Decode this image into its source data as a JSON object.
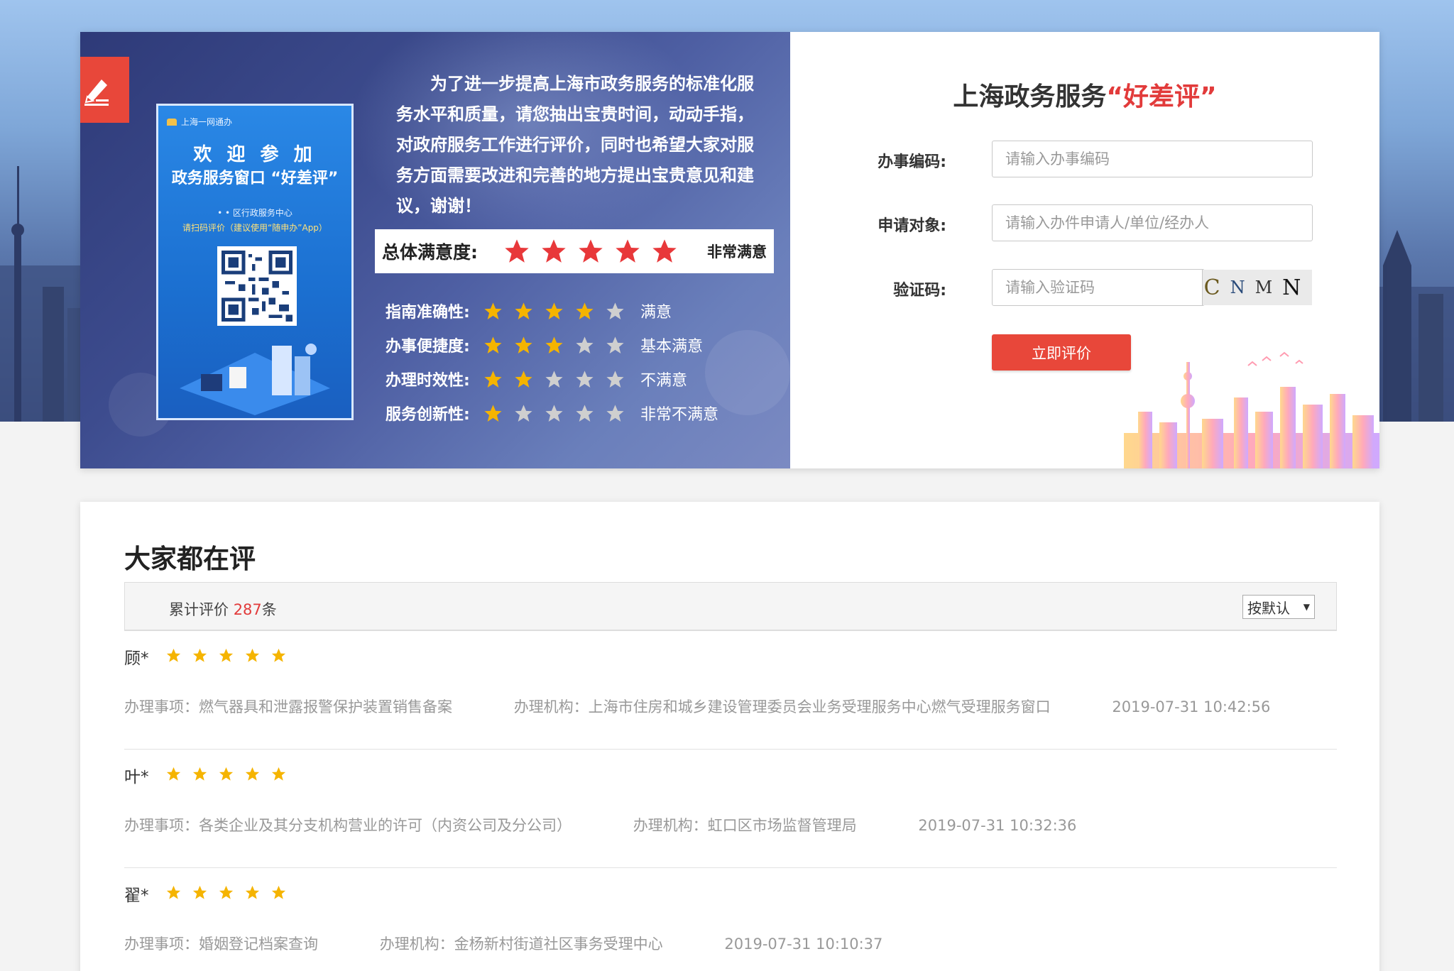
{
  "hero": {
    "poster": {
      "brand": "上海一网通办",
      "welcome": "欢 迎 参 加",
      "title": "政务服务窗口 “好差评”",
      "center": "• • 区行政服务中心",
      "scan_tip": "请扫码评价（建议使用“随申办”App）"
    },
    "intro": "为了进一步提高上海市政务服务的标准化服务水平和质量，请您抽出宝贵时间，动动手指，对政府服务工作进行评价，同时也希望大家对服务方面需要改进和完善的地方提出宝贵意见和建议，谢谢！",
    "overall": {
      "label": "总体满意度:",
      "stars": 5,
      "desc": "非常满意"
    },
    "criteria": [
      {
        "label": "指南准确性:",
        "stars": 4,
        "desc": "满意"
      },
      {
        "label": "办事便捷度:",
        "stars": 3,
        "desc": "基本满意"
      },
      {
        "label": "办理时效性:",
        "stars": 2,
        "desc": "不满意"
      },
      {
        "label": "服务创新性:",
        "stars": 1,
        "desc": "非常不满意"
      }
    ]
  },
  "form": {
    "title_prefix": "上海政务服务",
    "title_highlight": "“好差评”",
    "fields": {
      "code_label": "办事编码:",
      "code_placeholder": "请输入办事编码",
      "applicant_label": "申请对象:",
      "applicant_placeholder": "请输入办件申请人/单位/经办人",
      "captcha_label": "验证码:",
      "captcha_placeholder": "请输入验证码",
      "captcha_chars": [
        "C",
        "N",
        "M",
        "N"
      ]
    },
    "submit_label": "立即评价"
  },
  "reviews": {
    "heading": "大家都在评",
    "summary_prefix": "累计评价",
    "summary_count": "287",
    "summary_suffix": "条",
    "sort_value": "按默认",
    "items": [
      {
        "name": "顾*",
        "stars": 5,
        "matter": "办理事项：燃气器具和泄露报警保护装置销售备案",
        "agency": "办理机构：上海市住房和城乡建设管理委员会业务受理服务中心燃气受理服务窗口",
        "time": "2019-07-31 10:42:56"
      },
      {
        "name": "叶*",
        "stars": 5,
        "matter": "办理事项：各类企业及其分支机构营业的许可（内资公司及分公司）",
        "agency": "办理机构：虹口区市场监督管理局",
        "time": "2019-07-31 10:32:36"
      },
      {
        "name": "翟*",
        "stars": 5,
        "matter": "办理事项：婚姻登记档案查询",
        "agency": "办理机构：金杨新村街道社区事务受理中心",
        "time": "2019-07-31 10:10:37"
      }
    ]
  },
  "colors": {
    "accent_red": "#e8473a",
    "star_red": "#e8383a",
    "star_gold": "#f5b400",
    "star_gray": "#cfcfcf"
  },
  "icons": {
    "pen_badge": "pen-edit-icon",
    "star": "star-icon",
    "sort_arrow": "caret-down-icon"
  }
}
